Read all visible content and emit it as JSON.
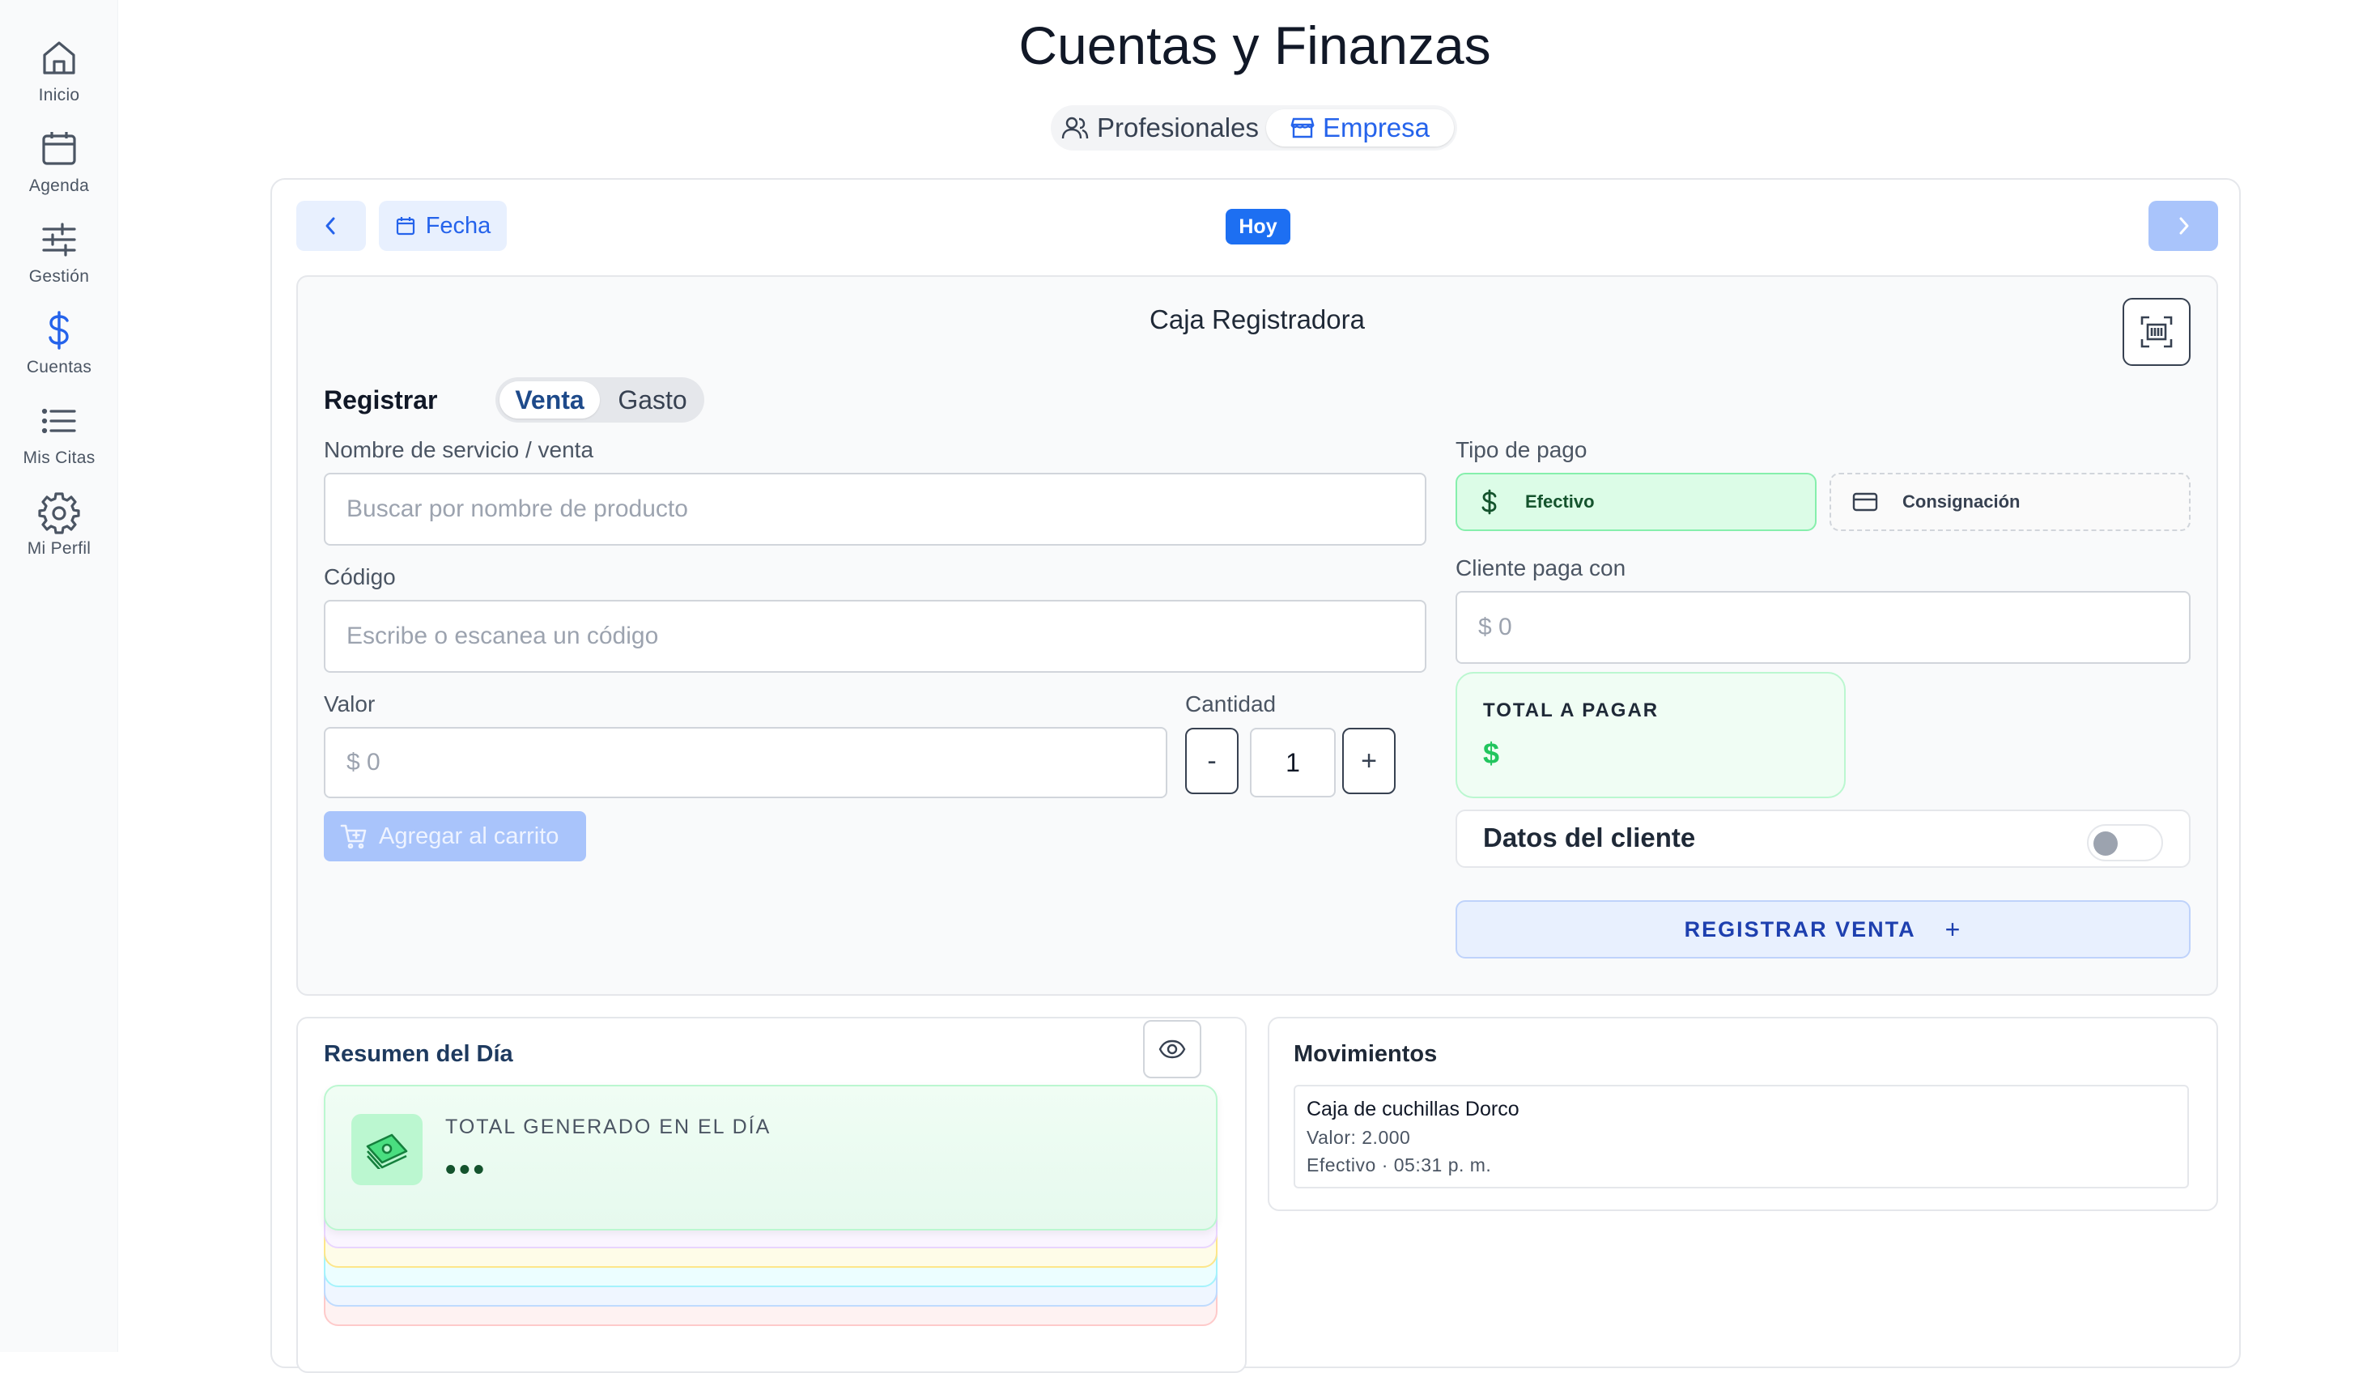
{
  "sidebar": {
    "items": [
      {
        "label": "Inicio",
        "icon": "home-icon"
      },
      {
        "label": "Agenda",
        "icon": "calendar-icon"
      },
      {
        "label": "Gestión",
        "icon": "sliders-icon"
      },
      {
        "label": "Cuentas",
        "icon": "dollar-icon",
        "active": true
      },
      {
        "label": "Mis Citas",
        "icon": "list-icon"
      },
      {
        "label": "Mi Perfil",
        "icon": "gear-icon"
      }
    ]
  },
  "header": {
    "title": "Cuentas y Finanzas",
    "tabs": [
      {
        "label": "Profesionales",
        "icon": "users-icon"
      },
      {
        "label": "Empresa",
        "icon": "store-icon",
        "active": true
      }
    ]
  },
  "date_nav": {
    "fecha_label": "Fecha",
    "today_badge": "Hoy"
  },
  "register": {
    "title": "Caja Registradora",
    "mode_label": "Registrar",
    "modes": [
      "Venta",
      "Gasto"
    ],
    "active_mode": "Venta",
    "service_label": "Nombre de servicio / venta",
    "service_placeholder": "Buscar por nombre de producto",
    "code_label": "Código",
    "code_placeholder": "Escribe o escanea un código",
    "value_label": "Valor",
    "value_placeholder": "$ 0",
    "qty_label": "Cantidad",
    "qty_minus": "-",
    "qty_value": "1",
    "qty_plus": "+",
    "add_cart_label": "Agregar al carrito",
    "payment_label": "Tipo de pago",
    "payment_options": [
      "Efectivo",
      "Consignación"
    ],
    "selected_payment": "Efectivo",
    "client_pays_label": "Cliente paga con",
    "client_pays_placeholder": "$ 0",
    "total_label": "TOTAL A PAGAR",
    "total_value": "$",
    "client_data_label": "Datos del cliente",
    "client_data_enabled": false,
    "submit_label": "REGISTRAR VENTA",
    "submit_icon": "+"
  },
  "summary": {
    "title": "Resumen del Día",
    "total_label": "TOTAL GENERADO EN EL DÍA",
    "total_value": "•••",
    "hidden": true
  },
  "movements": {
    "title": "Movimientos",
    "items": [
      {
        "name": "Caja de cuchillas Dorco",
        "value": "Valor: 2.000",
        "meta": "Efectivo  · 05:31 p. m."
      }
    ]
  },
  "colors": {
    "accent": "#2563eb",
    "badge": "#1d6ff2",
    "success": "#22c55e",
    "disabled_button": "#a9c4fb"
  }
}
